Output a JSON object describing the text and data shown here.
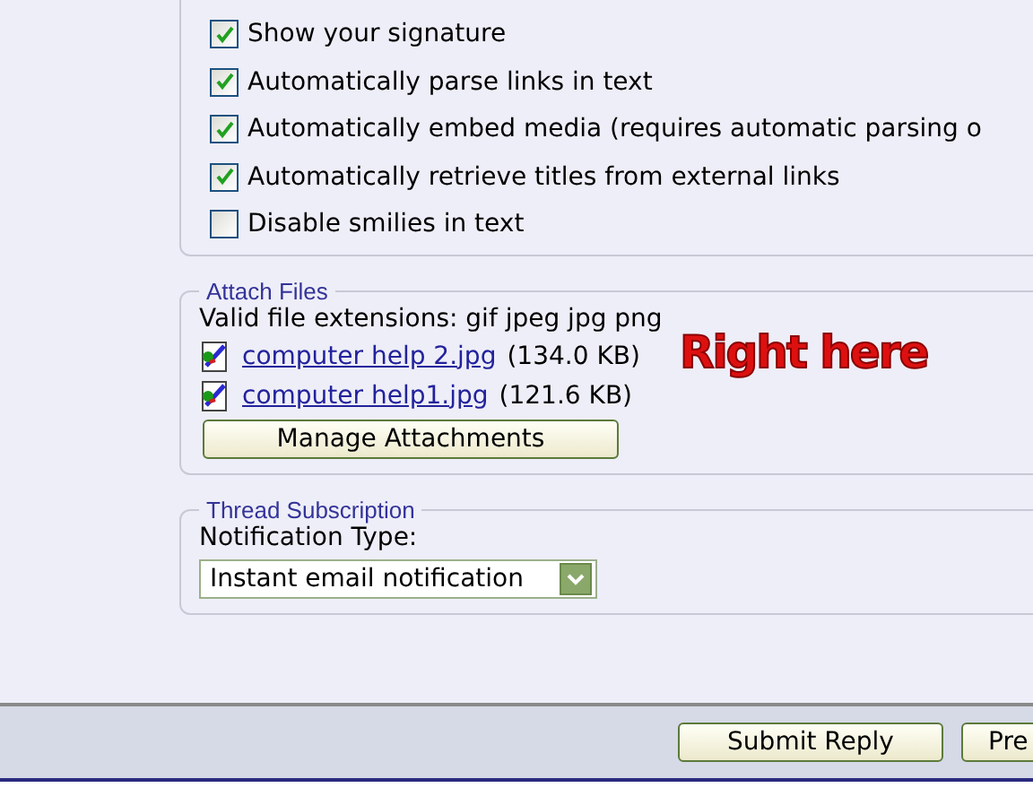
{
  "options": [
    {
      "label": "Show your signature",
      "checked": true
    },
    {
      "label": "Automatically parse links in text",
      "checked": true
    },
    {
      "label": "Automatically embed media (requires automatic parsing o",
      "checked": true
    },
    {
      "label": "Automatically retrieve titles from external links",
      "checked": true
    },
    {
      "label": "Disable smilies in text",
      "checked": false
    }
  ],
  "attach_files": {
    "legend": "Attach Files",
    "extensions": "Valid file extensions: gif jpeg jpg png",
    "files": [
      {
        "name": "computer help 2.jpg",
        "size": "(134.0 KB)"
      },
      {
        "name": "computer help1.jpg",
        "size": "(121.6 KB)"
      }
    ],
    "manage_button": "Manage Attachments",
    "annotation": "Right here"
  },
  "thread_subscription": {
    "legend": "Thread Subscription",
    "label": "Notification Type:",
    "value": "Instant email notification"
  },
  "buttons": [
    "Submit Reply",
    "Pre"
  ]
}
